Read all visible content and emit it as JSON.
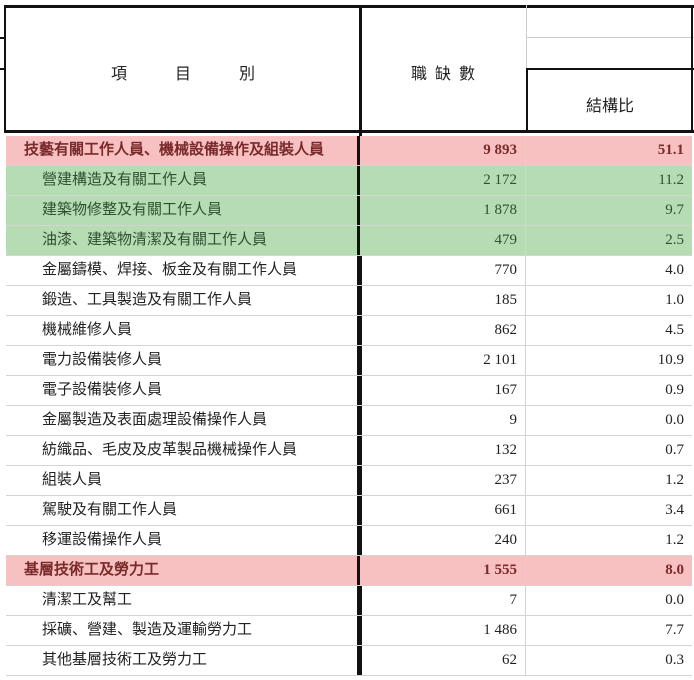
{
  "header": {
    "item_label": "項　　　目　　　別",
    "vacancies_label": "職 缺 數",
    "ratio_label": "結構比"
  },
  "rows": [
    {
      "label": "技藝有關工作人員、機械設備操作及組裝人員",
      "vacancies": "9 893",
      "ratio": "51.1",
      "style": "major"
    },
    {
      "label": "營建構造及有關工作人員",
      "vacancies": "2 172",
      "ratio": "11.2",
      "style": "green"
    },
    {
      "label": "建築物修整及有關工作人員",
      "vacancies": "1 878",
      "ratio": "9.7",
      "style": "green"
    },
    {
      "label": "油漆、建築物清潔及有關工作人員",
      "vacancies": "479",
      "ratio": "2.5",
      "style": "green"
    },
    {
      "label": "金屬鑄模、焊接、板金及有關工作人員",
      "vacancies": "770",
      "ratio": "4.0",
      "style": "sub"
    },
    {
      "label": "鍛造、工具製造及有關工作人員",
      "vacancies": "185",
      "ratio": "1.0",
      "style": "sub"
    },
    {
      "label": "機械維修人員",
      "vacancies": "862",
      "ratio": "4.5",
      "style": "sub"
    },
    {
      "label": "電力設備裝修人員",
      "vacancies": "2 101",
      "ratio": "10.9",
      "style": "sub"
    },
    {
      "label": "電子設備裝修人員",
      "vacancies": "167",
      "ratio": "0.9",
      "style": "sub"
    },
    {
      "label": "金屬製造及表面處理設備操作人員",
      "vacancies": "9",
      "ratio": "0.0",
      "style": "sub"
    },
    {
      "label": "紡織品、毛皮及皮革製品機械操作人員",
      "vacancies": "132",
      "ratio": "0.7",
      "style": "sub"
    },
    {
      "label": "組裝人員",
      "vacancies": "237",
      "ratio": "1.2",
      "style": "sub"
    },
    {
      "label": "駕駛及有關工作人員",
      "vacancies": "661",
      "ratio": "3.4",
      "style": "sub"
    },
    {
      "label": "移運設備操作人員",
      "vacancies": "240",
      "ratio": "1.2",
      "style": "sub"
    },
    {
      "label": "基層技術工及勞力工",
      "vacancies": "1 555",
      "ratio": "8.0",
      "style": "major"
    },
    {
      "label": "清潔工及幫工",
      "vacancies": "7",
      "ratio": "0.0",
      "style": "sub"
    },
    {
      "label": "採礦、營建、製造及運輸勞力工",
      "vacancies": "1 486",
      "ratio": "7.7",
      "style": "sub"
    },
    {
      "label": "其他基層技術工及勞力工",
      "vacancies": "62",
      "ratio": "0.3",
      "style": "sub"
    }
  ]
}
